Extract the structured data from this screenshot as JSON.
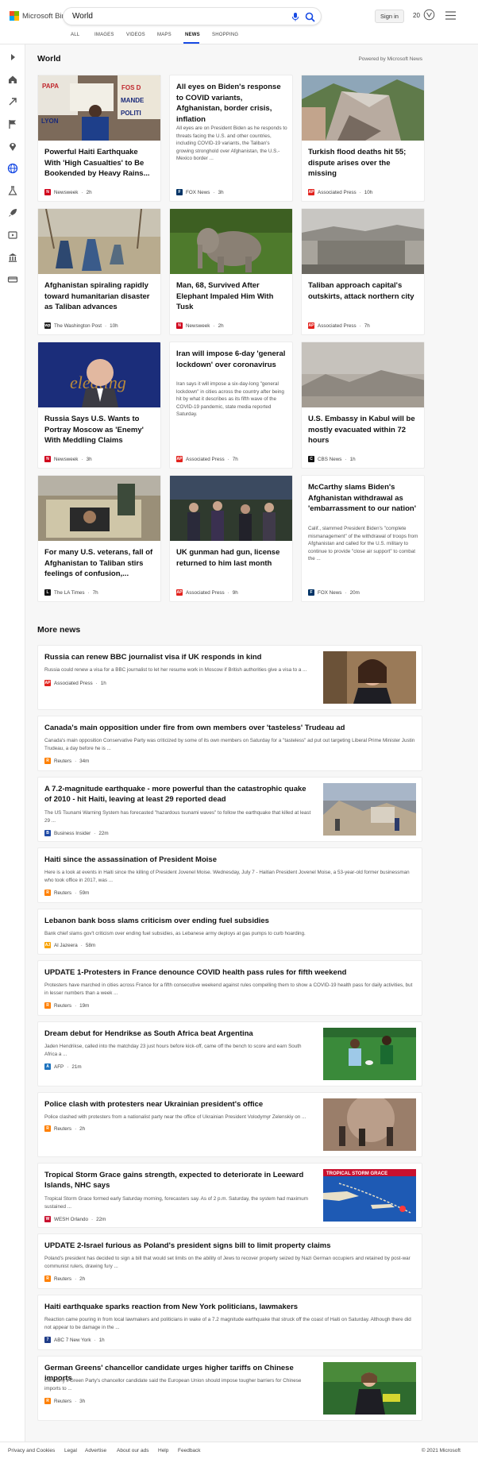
{
  "header": {
    "brand": "Microsoft Bing",
    "search_value": "World",
    "sign_in": "Sign in",
    "points": "20"
  },
  "tabs": [
    "ALL",
    "IMAGES",
    "VIDEOS",
    "MAPS",
    "NEWS",
    "SHOPPING"
  ],
  "active_tab": "NEWS",
  "section_title": "World",
  "powered_by": "Powered by Microsoft News",
  "cards": [
    {
      "title": "Powerful Haiti Earthquake With 'High Casualties' to Be Bookended by Heavy Rains...",
      "source": "Newsweek",
      "time": "2h",
      "image": "protest"
    },
    {
      "title": "All eyes on Biden's response to COVID variants, Afghanistan, border crisis, inflation",
      "snippet": "All eyes are on President Biden as he responds to threats facing the U.S. and other countries, including COVID-19 variants, the Taliban's growing stronghold over Afghanistan, the U.S.-Mexico border ...",
      "source": "FOX News",
      "time": "3h"
    },
    {
      "title": "Turkish flood deaths hit 55; dispute arises over the missing",
      "source": "Associated Press",
      "time": "10h",
      "image": "flood"
    },
    {
      "title": "Afghanistan spiraling rapidly toward humanitarian disaster as Taliban advances",
      "source": "The Washington Post",
      "time": "10h",
      "image": "afghan"
    },
    {
      "title": "Man, 68, Survived After Elephant Impaled Him With Tusk",
      "source": "Newsweek",
      "time": "2h",
      "image": "elephant"
    },
    {
      "title": "Taliban approach capital's outskirts, attack northern city",
      "source": "Associated Press",
      "time": "7h",
      "image": "kabul"
    },
    {
      "title": "Russia Says U.S. Wants to Portray Moscow as 'Enemy' With Meddling Claims",
      "source": "Newsweek",
      "time": "3h",
      "image": "official"
    },
    {
      "title": "Iran will impose 6-day 'general lockdown' over coronavirus",
      "snippet": "Iran says it will impose a six-day-long \"general lockdown\" in cities across the country after being hit by what it describes as its fifth wave of the COVID-19 pandemic, state media reported Saturday.",
      "source": "Associated Press",
      "time": "7h"
    },
    {
      "title": "U.S. Embassy in Kabul will be mostly evacuated within 72 hours",
      "source": "CBS News",
      "time": "1h",
      "image": "hills"
    },
    {
      "title": "For many U.S. veterans, fall of Afghanistan to Taliban stirs feelings of confusion,...",
      "source": "The LA Times",
      "time": "7h",
      "image": "truck"
    },
    {
      "title": "UK gunman had gun, license returned to him last month",
      "source": "Associated Press",
      "time": "9h",
      "image": "vigil"
    },
    {
      "title": "McCarthy slams Biden's Afghanistan withdrawal as 'embarrassment to our nation'",
      "snippet": "Calif., slammed President Biden's \"complete mismanagement\" of the withdrawal of troops from Afghanistan and called for the U.S. military to continue to provide \"close air support\" to combat the ...",
      "source": "FOX News",
      "time": "20m"
    }
  ],
  "more_news_title": "More news",
  "list": [
    {
      "title": "Russia can renew BBC journalist visa if UK responds in kind",
      "snippet": "Russia could renew a visa for a BBC journalist to let her resume work in Moscow if British authorities give a visa to a ...",
      "source": "Associated Press",
      "time": "1h",
      "image": "woman"
    },
    {
      "title": "Canada's main opposition under fire from own members over 'tasteless' Trudeau ad",
      "snippet": "Canada's main opposition Conservative Party was criticized by some of its own members on Saturday for a \"tasteless\" ad put out targeting Liberal Prime Minister Justin Trudeau, a day before he is ...",
      "source": "Reuters",
      "time": "34m"
    },
    {
      "title": "A 7.2-magnitude earthquake - more powerful than the catastrophic quake of 2010 - hit Haiti, leaving at least 29 reported dead",
      "snippet": "The US Tsunami Warning System has forecasted \"hazardous tsunami waves\" to follow the earthquake that killed at least 29 ...",
      "source": "Business Insider",
      "time": "22m",
      "image": "rubble"
    },
    {
      "title": "Haiti since the assassination of President Moise",
      "snippet": "Here is a look at events in Haiti since the killing of President Jovenel Moise. Wednesday, July 7 - Haitian President Jovenel Moise, a 53-year-old former businessman who took office in 2017, was ...",
      "source": "Reuters",
      "time": "59m"
    },
    {
      "title": "Lebanon bank boss slams criticism over ending fuel subsidies",
      "snippet": "Bank chief slams gov't criticism over ending fuel subsidies, as Lebanese army deploys at gas pumps to curb hoarding.",
      "source": "Al Jazeera",
      "time": "58m"
    },
    {
      "title": "UPDATE 1-Protesters in France denounce COVID health pass rules for fifth weekend",
      "snippet": "Protesters have marched in cities across France for a fifth consecutive weekend against rules compelling them to show a COVID-19 health pass for daily activities, but in lesser numbers than a week ...",
      "source": "Reuters",
      "time": "19m"
    },
    {
      "title": "Dream debut for Hendrikse as South Africa beat Argentina",
      "snippet": "Jaden Hendrikse, called into the matchday 23 just hours before kick-off, came off the bench to score and earn South Africa a ...",
      "source": "AFP",
      "time": "21m",
      "image": "rugby"
    },
    {
      "title": "Police clash with protesters near Ukrainian president's office",
      "snippet": "Police clashed with protesters from a nationalist party near the office of Ukrainian President Volodymyr Zelenskiy on ...",
      "source": "Reuters",
      "time": "2h",
      "image": "smoke"
    },
    {
      "title": "Tropical Storm Grace gains strength, expected to deteriorate in Leeward Islands, NHC says",
      "snippet": "Tropical Storm Grace formed early Saturday morning, forecasters say. As of 2 p.m. Saturday, the system had maximum sustained ...",
      "source": "WESH Orlando",
      "time": "22m",
      "image": "map"
    },
    {
      "title": "UPDATE 2-Israel furious as Poland's president signs bill to limit property claims",
      "snippet": "Poland's president has decided to sign a bill that would set limits on the ability of Jews to recover property seized by Nazi German occupiers and retained by post-war communist rulers, drawing fury ...",
      "source": "Reuters",
      "time": "2h"
    },
    {
      "title": "Haiti earthquake sparks reaction from New York politicians, lawmakers",
      "snippet": "Reaction came pouring in from local lawmakers and politicians in wake of a 7.2 magnitude earthquake that struck off the coast of Haiti on Saturday. Although there did not appear to be damage in the ...",
      "source": "ABC 7 New York",
      "time": "1h"
    },
    {
      "title": "German Greens' chancellor candidate urges higher tariffs on Chinese imports",
      "snippet": "Germany's Green Party's chancellor candidate said the European Union should impose tougher barriers for Chinese imports to ...",
      "source": "Reuters",
      "time": "3h",
      "image": "speaker"
    }
  ],
  "map_thumb_text": "TROPICAL STORM GRACE",
  "footer": {
    "links": [
      "Privacy and Cookies",
      "Legal",
      "Advertise",
      "About our ads",
      "Help",
      "Feedback"
    ],
    "copyright": "© 2021 Microsoft"
  },
  "colors": {
    "accent": "#174ae4",
    "ms_red": "#f25022",
    "ms_green": "#7fba00",
    "ms_blue": "#00a4ef",
    "ms_yellow": "#ffb900"
  }
}
